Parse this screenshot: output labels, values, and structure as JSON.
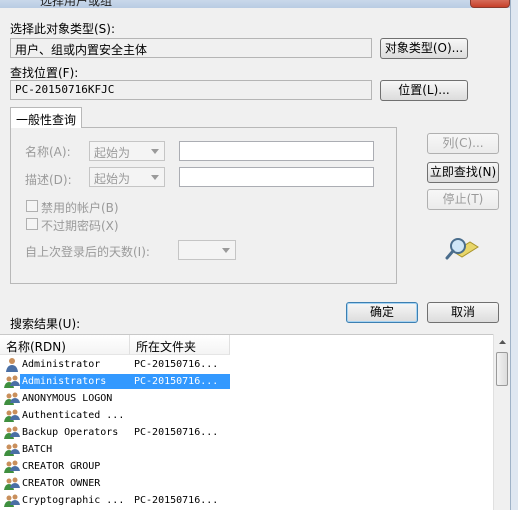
{
  "window": {
    "title": "选择用户或组"
  },
  "object_type": {
    "label": "选择此对象类型(S):",
    "value": "用户、组或内置安全主体",
    "button": "对象类型(O)..."
  },
  "location": {
    "label": "查找位置(F):",
    "value": "PC-20150716KFJC",
    "button": "位置(L)..."
  },
  "query": {
    "tab": "一般性查询",
    "name_label": "名称(A):",
    "name_combo": "起始为",
    "desc_label": "描述(D):",
    "desc_combo": "起始为",
    "disabled_accounts": "禁用的帐户(B)",
    "no_expire_pw": "不过期密码(X)",
    "days_since_login": "自上次登录后的天数(I):"
  },
  "buttons": {
    "columns": "列(C)...",
    "find_now": "立即查找(N)",
    "stop": "停止(T)",
    "ok": "确定",
    "cancel": "取消"
  },
  "results": {
    "label": "搜索结果(U):",
    "columns": [
      "名称(RDN)",
      "所在文件夹"
    ],
    "rows": [
      {
        "name": "Administrator",
        "folder": "PC-20150716...",
        "icon": "user-icon",
        "selected": false
      },
      {
        "name": "Administrators",
        "folder": "PC-20150716...",
        "icon": "group-icon",
        "selected": true
      },
      {
        "name": "ANONYMOUS LOGON",
        "folder": "",
        "icon": "group-icon",
        "selected": false
      },
      {
        "name": "Authenticated ...",
        "folder": "",
        "icon": "group-icon",
        "selected": false
      },
      {
        "name": "Backup Operators",
        "folder": "PC-20150716...",
        "icon": "group-icon",
        "selected": false
      },
      {
        "name": "BATCH",
        "folder": "",
        "icon": "group-icon",
        "selected": false
      },
      {
        "name": "CREATOR GROUP",
        "folder": "",
        "icon": "group-icon",
        "selected": false
      },
      {
        "name": "CREATOR OWNER",
        "folder": "",
        "icon": "group-icon",
        "selected": false
      },
      {
        "name": "Cryptographic ...",
        "folder": "PC-20150716...",
        "icon": "group-icon",
        "selected": false
      }
    ]
  },
  "colors": {
    "selection": "#3399ff",
    "default_button_border": "#3c7fb1"
  }
}
